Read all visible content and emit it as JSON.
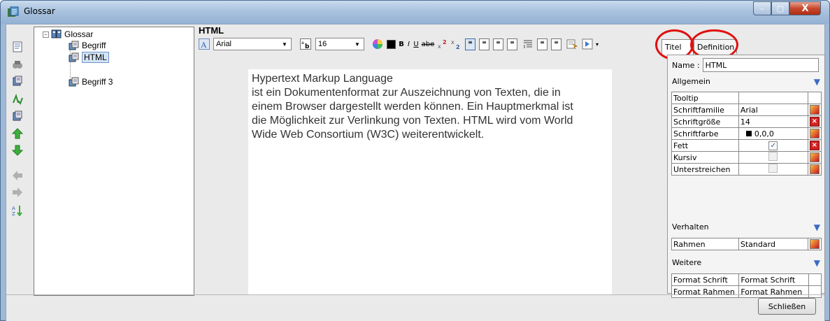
{
  "window": {
    "title": "Glossar",
    "minimize_label": "–",
    "maximize_label": "▢",
    "close_label": "X"
  },
  "tree": {
    "root": "Glossar",
    "children": [
      "Begriff",
      "HTML",
      "Begriff 3"
    ],
    "selected": "HTML"
  },
  "editor": {
    "title": "HTML",
    "font_name": "Arial",
    "font_size": "16",
    "text_lines": [
      "Hypertext Markup Language",
      "ist ein Dokumentenformat zur Auszeichnung von Texten, die in",
      "einem Browser dargestellt werden können. Ein Hauptmerkmal ist",
      "die Möglichkeit zur Verlinkung von Texten. HTML wird vom World",
      "Wide Web Consortium (W3C) weiterentwickelt."
    ],
    "bold_label": "B",
    "italic_label": "I",
    "underline_label": "U",
    "strike_label": "abe"
  },
  "props": {
    "tabs": [
      "Titel",
      "Definition"
    ],
    "name_label": "Name :",
    "name_value": "HTML",
    "section_general": "Allgemein",
    "section_behavior": "Verhalten",
    "section_more": "Weitere",
    "general_rows": [
      {
        "label": "Tooltip",
        "value": ""
      },
      {
        "label": "Schriftfamilie",
        "value": "Arial"
      },
      {
        "label": "Schriftgröße",
        "value": "14"
      },
      {
        "label": "Schriftfarbe",
        "value": "0,0,0"
      },
      {
        "label": "Fett",
        "value": ""
      },
      {
        "label": "Kursiv",
        "value": ""
      },
      {
        "label": "Unterstreichen",
        "value": ""
      }
    ],
    "behavior_rows": [
      {
        "label": "Rahmen",
        "value": "Standard"
      }
    ],
    "more_rows": [
      {
        "label": "Format Schrift",
        "value": "Format Schrift"
      },
      {
        "label": "Format Rahmen",
        "value": "Format Rahmen"
      }
    ],
    "fett_checked": true,
    "kursiv_checked": false,
    "unterstreichen_checked": false
  },
  "footer": {
    "close_button": "Schließen"
  },
  "colors": {
    "annotation_circle": "#e01010",
    "titlebar": "#a9c2de",
    "selection": "#d4e4f7"
  }
}
